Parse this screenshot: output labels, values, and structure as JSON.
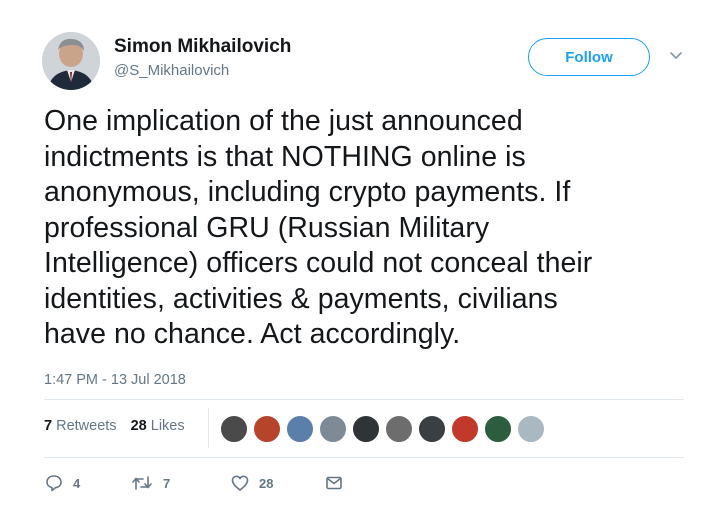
{
  "author": {
    "name": "Simon Mikhailovich",
    "handle": "@S_Mikhailovich"
  },
  "follow_label": "Follow",
  "tweet": {
    "lines": [
      "One implication of the just announced",
      "indictments is that NOTHING online is",
      "anonymous, including crypto payments. If",
      "professional GRU (Russian Military",
      "Intelligence) officers could not conceal their",
      "identities, activities & payments, civilians",
      "have no chance. Act accordingly."
    ],
    "timestamp": "1:47 PM - 13 Jul 2018"
  },
  "stats": {
    "retweets_count": "7",
    "retweets_label": "Retweets",
    "likes_count": "28",
    "likes_label": "Likes"
  },
  "liker_avatars": [
    {
      "color": "#4a4a4a",
      "icon": "user-avatar"
    },
    {
      "color": "#b5442a",
      "icon": "user-avatar"
    },
    {
      "color": "#5a7fa8",
      "icon": "user-avatar"
    },
    {
      "color": "#7e8b96",
      "icon": "user-avatar"
    },
    {
      "color": "#2f3437",
      "icon": "user-avatar"
    },
    {
      "color": "#6d6d6d",
      "icon": "user-avatar"
    },
    {
      "color": "#3a3f44",
      "icon": "user-avatar"
    },
    {
      "color": "#c0392b",
      "icon": "user-avatar"
    },
    {
      "color": "#2c5d3f",
      "icon": "user-avatar"
    },
    {
      "color": "#aab8c2",
      "icon": "default-egg-avatar"
    }
  ],
  "actions": {
    "reply_count": "4",
    "retweet_count": "7",
    "like_count": "28",
    "dm_icon": "envelope-icon"
  }
}
